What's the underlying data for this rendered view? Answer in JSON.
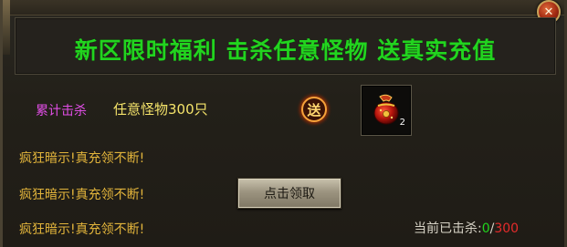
{
  "dialog": {
    "title": "新区限时福利 击杀任意怪物 送真实充值",
    "close_icon": "close-icon",
    "colors": {
      "title": "#22d41f",
      "accent_magenta": "#e14ee6",
      "accent_yellow": "#f4e36a",
      "hint": "#e2b43b",
      "progress_current": "#21d41d",
      "progress_total": "#e52b2b"
    }
  },
  "task": {
    "label": "累计击杀",
    "requirement": "任意怪物300只",
    "gift_icon_char": "送",
    "reward_item": {
      "icon": "red-pouch-icon",
      "count": "2"
    }
  },
  "hints": [
    "疯狂暗示!真充领不断!",
    "疯狂暗示!真充领不断!",
    "疯狂暗示!真充领不断!"
  ],
  "claim_button": {
    "label": "点击领取"
  },
  "progress": {
    "label": "当前已击杀:",
    "current": "0",
    "separator": "/",
    "total": "300"
  }
}
